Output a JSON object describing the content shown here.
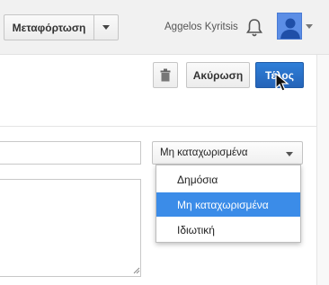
{
  "header": {
    "upload_label": "Μεταφόρτωση",
    "username": "Aggelos Kyritsis",
    "bell_icon": "bell-icon",
    "avatar_icon": "user-avatar-icon"
  },
  "toolbar": {
    "trash_icon": "trash-icon",
    "cancel_label": "Ακύρωση",
    "done_label": "Τέλος"
  },
  "form": {
    "title_value": "",
    "description_value": ""
  },
  "privacy": {
    "selected": "Μη καταχωρισμένα",
    "options": [
      "Δημόσια",
      "Μη καταχωρισμένα",
      "Ιδιωτική"
    ],
    "highlighted_option": "Μη καταχωρισμένα"
  },
  "colors": {
    "accent": "#2f7fd8",
    "highlight": "#3b8ce8",
    "avatar": "#5c8ee6"
  }
}
